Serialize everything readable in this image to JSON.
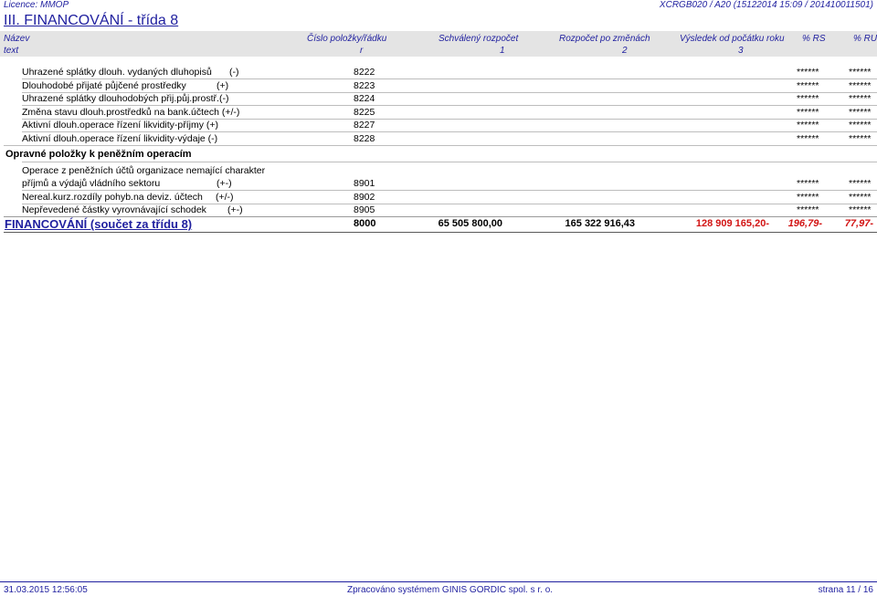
{
  "license": "Licence: MMOP",
  "report_code": "XCRGB020 / A20  (15122014 15:09 / 201410011501)",
  "title": "III. FINANCOVÁNÍ - třída 8",
  "headers": {
    "nazev": "Název",
    "cislo": "Číslo položky/řádku",
    "schvaleny": "Schválený rozpočet",
    "po_zmenach": "Rozpočet po změnách",
    "vysledek": "Výsledek od počátku roku",
    "rs": "% RS",
    "ru": "% RU",
    "sub_text": "text",
    "sub_r": "r",
    "sub_1": "1",
    "sub_2": "2",
    "sub_3": "3"
  },
  "rows": [
    {
      "name": "Uhrazené splátky dlouh. vydaných dluhopisů",
      "sign": "(-)",
      "num": "8222",
      "rs": "******",
      "ru": "******"
    },
    {
      "name": "Dlouhodobé přijaté půjčené prostředky",
      "sign": "(+)",
      "num": "8223",
      "rs": "******",
      "ru": "******"
    },
    {
      "name": "Uhrazené splátky dlouhodobých přij.půj.prostř.(-)",
      "sign": "",
      "num": "8224",
      "rs": "******",
      "ru": "******"
    },
    {
      "name": "Změna stavu dlouh.prostředků na bank.účtech (+/-)",
      "sign": "",
      "num": "8225",
      "rs": "******",
      "ru": "******"
    },
    {
      "name": "Aktivní dlouh.operace řízení likvidity-příjmy (+)",
      "sign": "",
      "num": "8227",
      "rs": "******",
      "ru": "******"
    },
    {
      "name": "Aktivní dlouh.operace řízení likvidity-výdaje (-)",
      "sign": "",
      "num": "8228",
      "rs": "******",
      "ru": "******"
    }
  ],
  "section": "Opravné položky k peněžním operacím",
  "multi_row": {
    "line1": "Operace z peněžních účtů organizace nemající charakter",
    "line2": "příjmů a výdajů vládního sektoru",
    "sign": "(+-)",
    "num": "8901",
    "rs": "******",
    "ru": "******"
  },
  "rows2": [
    {
      "name": "Nereal.kurz.rozdíly pohyb.na deviz. účtech",
      "sign": "(+/-)",
      "num": "8902",
      "rs": "******",
      "ru": "******"
    },
    {
      "name": "Nepřevedené částky vyrovnávající schodek",
      "sign": "(+-)",
      "num": "8905",
      "rs": "******",
      "ru": "******"
    }
  ],
  "total": {
    "label": "FINANCOVÁNÍ (součet za třídu 8)",
    "num": "8000",
    "schvaleny": "65 505 800,00",
    "po_zmenach": "165 322 916,43",
    "vysledek": "128 909 165,20-",
    "rs": "196,79-",
    "ru": "77,97-"
  },
  "footer": {
    "date": "31.03.2015 12:56:05",
    "processed": "Zpracováno systémem  GINIS GORDIC spol. s  r. o.",
    "page": "strana 11 / 16"
  }
}
